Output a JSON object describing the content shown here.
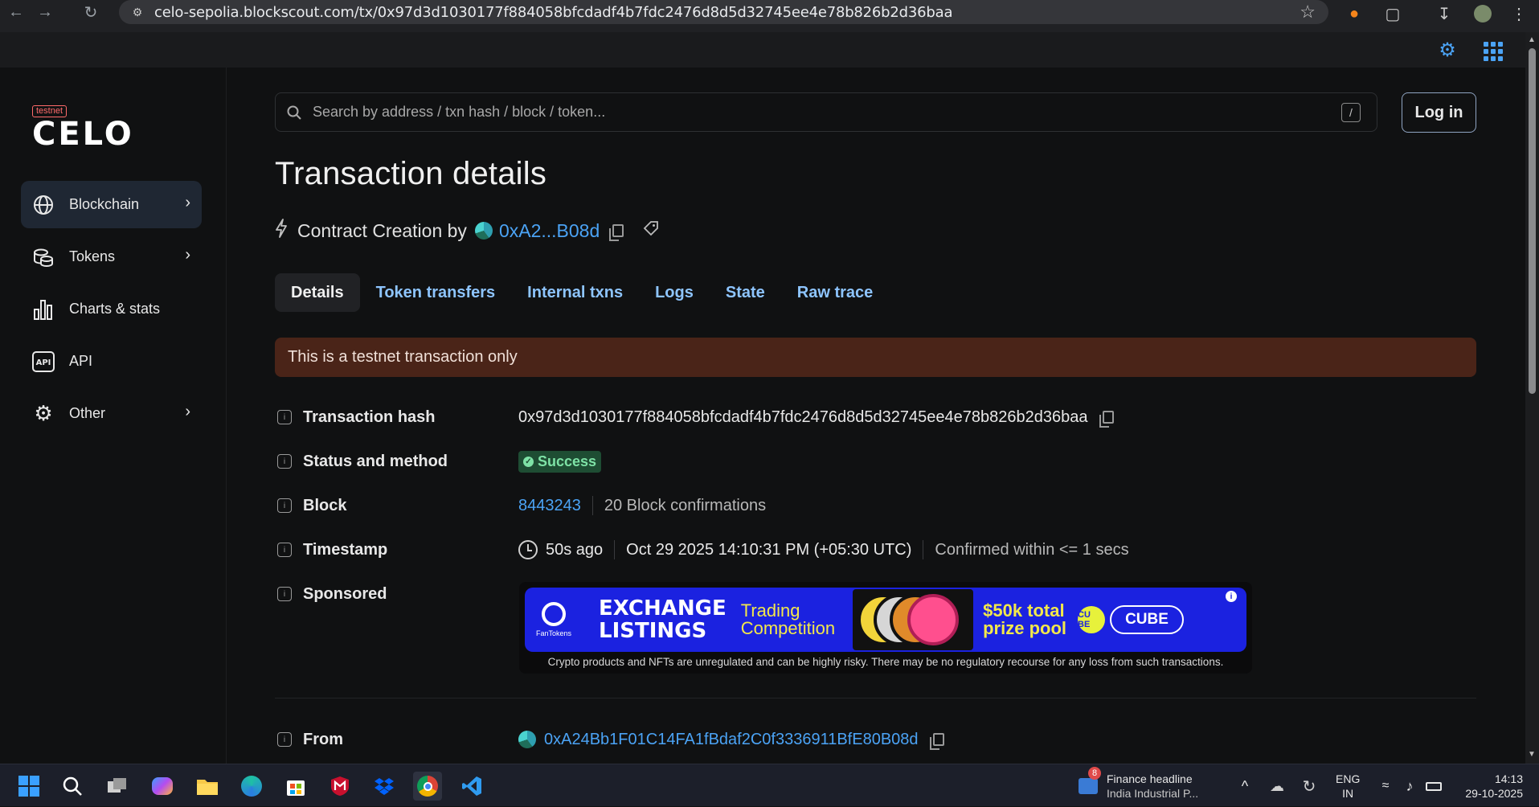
{
  "browser": {
    "url": "celo-sepolia.blockscout.com/tx/0x97d3d1030177f884058bfcdadf4b7fdc2476d8d5d32745ee4e78b826b2d36baa"
  },
  "sidebar": {
    "logo_tag": "testnet",
    "logo_word": "CELO",
    "items": [
      {
        "label": "Blockchain"
      },
      {
        "label": "Tokens"
      },
      {
        "label": "Charts & stats"
      },
      {
        "label": "API"
      },
      {
        "label": "Other"
      }
    ]
  },
  "search": {
    "placeholder": "Search by address / txn hash / block / token...",
    "shortcut": "/"
  },
  "header": {
    "login_label": "Log in"
  },
  "page": {
    "title": "Transaction details",
    "subtitle_prefix": "Contract Creation by",
    "creator_short": "0xA2...B08d"
  },
  "tabs": [
    {
      "label": "Details"
    },
    {
      "label": "Token transfers"
    },
    {
      "label": "Internal txns"
    },
    {
      "label": "Logs"
    },
    {
      "label": "State"
    },
    {
      "label": "Raw trace"
    }
  ],
  "banner": "This is a testnet transaction only",
  "details": {
    "hash_label": "Transaction hash",
    "hash_value": "0x97d3d1030177f884058bfcdadf4b7fdc2476d8d5d32745ee4e78b826b2d36baa",
    "status_label": "Status and method",
    "status_value": "Success",
    "block_label": "Block",
    "block_value": "8443243",
    "block_confirmations": "20 Block confirmations",
    "timestamp_label": "Timestamp",
    "timestamp_ago": "50s ago",
    "timestamp_full": "Oct 29 2025 14:10:31 PM (+05:30 UTC)",
    "timestamp_confirmed": "Confirmed within <= 1 secs",
    "sponsored_label": "Sponsored",
    "from_label": "From",
    "from_value": "0xA24Bb1F01C14FA1fBdaf2C0f3336911BfE80B08d"
  },
  "ad": {
    "brand": "FanTokens",
    "headline_1": "EXCHANGE",
    "headline_2": "LISTINGS",
    "trading_1": "Trading",
    "trading_2": "Competition",
    "prize_1": "$50k total",
    "prize_2": "prize pool",
    "cube_icon": "CU BE",
    "cube_label": "CUBE",
    "disclaimer": "Crypto products and NFTs are unregulated and can be highly risky. There may be no regulatory recourse for any loss from such transactions."
  },
  "taskbar": {
    "news_badge": "8",
    "news_title": "Finance headline",
    "news_sub": "India Industrial P...",
    "lang_1": "ENG",
    "lang_2": "IN",
    "time": "14:13",
    "date": "29-10-2025"
  },
  "colors": {
    "accent": "#4ba3f5",
    "banner_bg": "#4a2418",
    "success": "#7ee2a6"
  }
}
